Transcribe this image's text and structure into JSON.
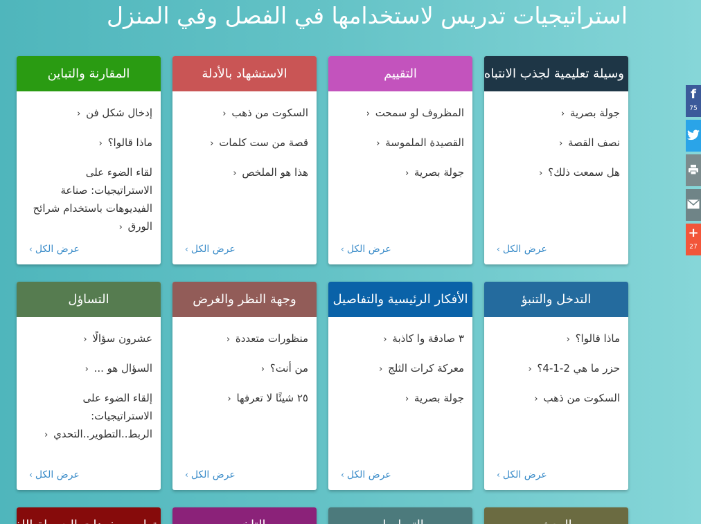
{
  "page": {
    "title": "استراتيجيات تدريس لاستخدامها في الفصل وفي المنزل"
  },
  "view_all_label": "عرض الكل",
  "cards": [
    {
      "title": "وسيلة تعليمية لجذب الانتباه",
      "color": "#1e3646",
      "items": [
        "جولة بصرية",
        "نصف القصة",
        "هل سمعت ذلك؟"
      ]
    },
    {
      "title": "التقييم",
      "color": "#c353bd",
      "items": [
        "المظروف لو سمحت",
        "القصيدة الملموسة",
        "جولة بصرية"
      ]
    },
    {
      "title": "الاستشهاد بالأدلة",
      "color": "#c95555",
      "items": [
        "السكوت من ذهب",
        "قصة من ست كلمات",
        "هذا هو الملخص"
      ]
    },
    {
      "title": "المقارنة والتباين",
      "color": "#2a9b12",
      "items": [
        "إدخال شكل فن",
        "ماذا قالوا؟",
        "لقاء الضوء على الاستراتيجيات: صناعة الفيديوهات باستخدام شرائح الورق"
      ]
    },
    {
      "title": "التدخل والتنبؤ",
      "color": "#246b9e",
      "items": [
        "ماذا قالوا؟",
        "حزر ما هي 2-1-4؟",
        "السكوت من ذهب"
      ]
    },
    {
      "title": "الأفكار الرئيسية والتفاصيل",
      "color": "#0a62a8",
      "items": [
        "٣ صادقة وا كاذبة",
        "معركة كرات الثلج",
        "جولة بصرية"
      ]
    },
    {
      "title": "وجهة النظر والغرض",
      "color": "#925c58",
      "items": [
        "منظورات متعددة",
        "من أنت؟",
        "٢٥ شيئًا لا تعرفها"
      ]
    },
    {
      "title": "التساؤل",
      "color": "#567c50",
      "items": [
        "عشرون سؤالًا",
        "السؤال هو ...",
        "إلقاء الضوء على الاستراتيجيات: الربط..التطوير..التحدي"
      ]
    },
    {
      "title": "البحث",
      "color": "#6b6b41",
      "items": []
    },
    {
      "title": "التسلسل",
      "color": "#4c7a7c",
      "items": []
    },
    {
      "title": "التلخيص",
      "color": "#8b2279",
      "items": []
    },
    {
      "title": "تطوير مفردات الحصيلة اللغوية",
      "color": "#860b0b",
      "items": []
    }
  ],
  "share": {
    "facebook": {
      "icon": "facebook-icon",
      "count": "75",
      "color": "#3b5a9a"
    },
    "twitter": {
      "icon": "twitter-icon",
      "color": "#2aa4e8"
    },
    "print": {
      "icon": "print-icon",
      "color": "#7b8b8d"
    },
    "email": {
      "icon": "email-icon",
      "color": "#6f8487"
    },
    "more": {
      "icon": "plus-icon",
      "count": "27",
      "color": "#f2563a"
    }
  }
}
